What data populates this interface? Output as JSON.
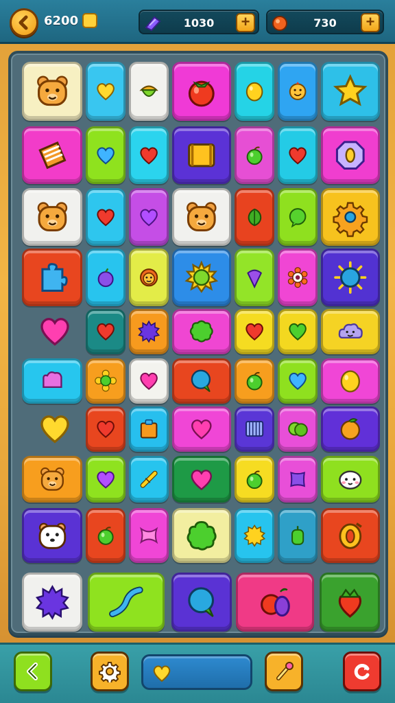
{
  "header": {
    "coins": "6200",
    "gems": "1030",
    "orbs": "730",
    "plus_label": "+"
  },
  "colors": {
    "accent": "#f3a51a",
    "board": "#4f6c79"
  },
  "board": {
    "tiles": [
      {
        "color": "#f7f0c2",
        "icon": "bear-face-icon"
      },
      {
        "color": "#39c6f0",
        "icon": "yellow-heart-icon"
      },
      {
        "color": "#f2f2ee",
        "icon": "acorn-icon"
      },
      {
        "color": "#f03ad6",
        "icon": "tomato-icon"
      },
      {
        "color": "#25d3e6",
        "icon": "lemon-icon"
      },
      {
        "color": "#2fa5f2",
        "icon": "smiley-icon"
      },
      {
        "color": "#2ec0e8",
        "icon": "star-icon"
      },
      {
        "color": "#f23cc9",
        "icon": "gift-box-icon"
      },
      {
        "color": "#8fe21e",
        "icon": "blue-heart-icon"
      },
      {
        "color": "#2bd4ee",
        "icon": "red-heart-icon"
      },
      {
        "color": "#5b32d6",
        "icon": "crate-icon"
      },
      {
        "color": "#e64fd4",
        "icon": "green-apple-icon"
      },
      {
        "color": "#24cbe6",
        "icon": "red-heart-icon"
      },
      {
        "color": "#f03ecf",
        "icon": "octagon-gem-icon"
      },
      {
        "color": "#f1f1ee",
        "icon": "bear-face-icon"
      },
      {
        "color": "#2ec6ee",
        "icon": "red-heart-icon"
      },
      {
        "color": "#c54ee6",
        "icon": "purple-heart-icon"
      },
      {
        "color": "#f1f1ee",
        "icon": "bear-face-icon"
      },
      {
        "color": "#e8431f",
        "icon": "green-leaf-icon"
      },
      {
        "color": "#8fe01f",
        "icon": "green-bubble-icon"
      },
      {
        "color": "#f7c21e",
        "icon": "gear-icon"
      },
      {
        "color": "#e8461f",
        "icon": "puzzle-piece-icon"
      },
      {
        "color": "#28c4ee",
        "icon": "purple-apple-icon"
      },
      {
        "color": "#e3ec48",
        "icon": "lion-face-icon"
      },
      {
        "color": "#2d8de8",
        "icon": "sun-icon"
      },
      {
        "color": "#93e428",
        "icon": "purple-drop-icon"
      },
      {
        "color": "#f046d4",
        "icon": "eye-flower-icon"
      },
      {
        "color": "#5232d2",
        "icon": "blue-sun-icon"
      },
      {
        "color": "#1b8a86",
        "icon": "red-heart-icon"
      },
      {
        "color": "#f79a1e",
        "icon": "purple-spiky-icon"
      },
      {
        "color": "#ef46d2",
        "icon": "green-cookie-icon"
      },
      {
        "color": "#f5dc21",
        "icon": "red-heart-icon"
      },
      {
        "color": "#f3d820",
        "icon": "green-heart-icon"
      },
      {
        "color": "#f5d324",
        "icon": "cloud-face-icon"
      },
      {
        "color": "#27c6ee",
        "icon": "pink-cloud-icon"
      },
      {
        "color": "#f79e1e",
        "icon": "green-flower-icon"
      },
      {
        "color": "#f3f3ee",
        "icon": "pink-heart-icon"
      },
      {
        "color": "#e8461f",
        "icon": "blue-balloon-icon"
      },
      {
        "color": "#f79e1e",
        "icon": "green-apple-icon"
      },
      {
        "color": "#8fe01f",
        "icon": "blue-heart-icon"
      },
      {
        "color": "#f046d6",
        "icon": "lemon-icon"
      },
      {
        "color": "#e8461f",
        "icon": "red-heart-icon"
      },
      {
        "color": "#27bfee",
        "icon": "orange-box-icon"
      },
      {
        "color": "#f046d6",
        "icon": "pink-heart-icon"
      },
      {
        "color": "#5a36d6",
        "icon": "cage-icon"
      },
      {
        "color": "#e84fd8",
        "icon": "green-bean-icon"
      },
      {
        "color": "#6130d8",
        "icon": "orange-fruit-icon"
      },
      {
        "color": "#f79e1e",
        "icon": "bear-face-icon"
      },
      {
        "color": "#8fe21f",
        "icon": "purple-heart-icon"
      },
      {
        "color": "#27c4ee",
        "icon": "candy-stick-icon"
      },
      {
        "color": "#1e9a46",
        "icon": "pink-heart-icon"
      },
      {
        "color": "#f6dc22",
        "icon": "green-apple-icon"
      },
      {
        "color": "#e84fd8",
        "icon": "purple-square-icon"
      },
      {
        "color": "#8fe01f",
        "icon": "white-face-icon"
      },
      {
        "color": "#5a32d4",
        "icon": "hamster-face-icon"
      },
      {
        "color": "#e8461f",
        "icon": "green-apple-icon"
      },
      {
        "color": "#f046d6",
        "icon": "pink-bow-icon"
      },
      {
        "color": "#f2eea0",
        "icon": "green-bush-icon"
      },
      {
        "color": "#27c4ee",
        "icon": "yellow-sun-icon"
      },
      {
        "color": "#2fa0c8",
        "icon": "green-pepper-icon"
      },
      {
        "color": "#e8461f",
        "icon": "ring-icon"
      },
      {
        "color": "#f1f1ee",
        "icon": "purple-spiky-icon"
      },
      {
        "color": "#8fe21f",
        "icon": "blue-wave-icon"
      },
      {
        "color": "#5a32d4",
        "icon": "blue-balloon-icon"
      },
      {
        "color": "#f03a86",
        "icon": "fruit-pair-icon"
      },
      {
        "color": "#3aa22e",
        "icon": "strawberry-icon"
      }
    ],
    "loose_pieces": [
      {
        "icon": "pink-heart-icon"
      },
      {
        "icon": "yellow-heart-icon"
      }
    ]
  },
  "footer": {
    "buttons": [
      {
        "name": "back-button",
        "icon": "chevron-left-icon",
        "color": "#8fe01f"
      },
      {
        "name": "settings-button",
        "icon": "gear-icon",
        "color": "#f7b22a"
      },
      {
        "name": "hint-button",
        "icon": "magic-wand-icon",
        "color": "#f7b22a"
      },
      {
        "name": "shuffle-button",
        "icon": "restart-icon",
        "color": "#ef3b30"
      }
    ],
    "bar_icon": "yellow-heart-icon"
  }
}
